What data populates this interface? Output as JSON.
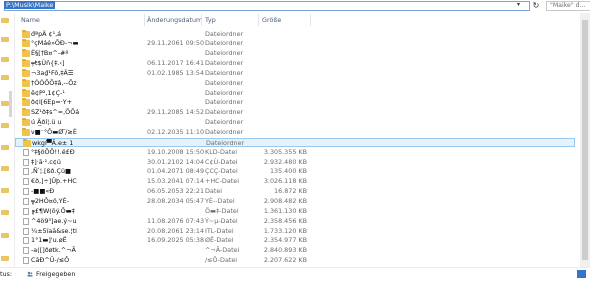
{
  "address": {
    "path": "P:\\Musik\\Maike",
    "search_placeholder": "\"Maike\" d..."
  },
  "headers": {
    "name": "Name",
    "date": "Änderungsdatum",
    "type": "Typ",
    "size": "Größe"
  },
  "rows": [
    {
      "name": "đªpÄ ¢¹‚á",
      "date": "",
      "type": "Dateiordner",
      "size": "",
      "icon": "folder-icon"
    },
    {
      "name": "°çMáé»ÕÐ-­¬▬",
      "date": "29.11.2061 09:50",
      "type": "Dateiordner",
      "size": "",
      "icon": "folder-icon"
    },
    {
      "name": "È§[†B¤^-#º",
      "date": "",
      "type": "Dateiordner",
      "size": "",
      "icon": "folder-icon"
    },
    {
      "name": "╤ŧ$Úñ{‡.‹]",
      "date": "06.11.2017 16:41",
      "type": "Dateiordner",
      "size": "",
      "icon": "folder-icon"
    },
    {
      "name": "¬3a₫¹Fõ,‡Ä☰",
      "date": "01.02.1985 13:54",
      "type": "Dateiordner",
      "size": "",
      "icon": "folder-icon"
    },
    {
      "name": "†ÓÓÕÕ‡â,--Õz",
      "date": "",
      "type": "Dateiordner",
      "size": "",
      "icon": "folder-icon"
    },
    {
      "name": "ê¢P²,1¢Ç-¹",
      "date": "",
      "type": "Dateiordner",
      "size": "",
      "icon": "folder-icon"
    },
    {
      "name": "ð¢l[6Ep=·Y+",
      "date": "",
      "type": "Dateiordner",
      "size": "",
      "icon": "folder-icon"
    },
    {
      "name": "SZ¹ð‡s^=,ÕÕá",
      "date": "29.11.2085 14:52",
      "type": "Dateiordner",
      "size": "",
      "icon": "folder-icon"
    },
    {
      "name": "ú Ä̲ðí¦.ü u",
      "date": "",
      "type": "Dateiordner",
      "size": "",
      "icon": "folder-icon"
    },
    {
      "name": "ν■⁻°Ô▬Ø ̅/≥È",
      "date": "02.12.2035 11:10",
      "type": "Dateiordner",
      "size": "",
      "icon": "folder-icon"
    },
    {
      "name": "wkgí▀Ã.e± 1",
      "date": "",
      "type": "Dateiordner",
      "size": "",
      "icon": "folder-icon",
      "selected": true
    },
    {
      "name": "°‡§öÕÕ!!.ë£Ð",
      "date": "19.10.2008 15:50",
      "type": "KLD-Datei",
      "size": "3.305.355 KB",
      "icon": "file-icon"
    },
    {
      "name": "‡]·ã·¹.c¢ü",
      "date": "30.01.2102 14:04",
      "type": "C¢Ù-Datei",
      "size": "2.932.480 KB",
      "icon": "file-icon"
    },
    {
      "name": "‚Ñ ́¦.[ßð.Çü■",
      "date": "01.04.2071 08:49",
      "type": "ÇCÇ-Datei",
      "size": "135.400 KB",
      "icon": "file-icon"
    },
    {
      "name": "€ð‚]÷]Ûþ.+HC",
      "date": "15.03.2041 07:14",
      "type": "+HC-Datei",
      "size": "3.026.118 KB",
      "icon": "file-icon"
    },
    {
      "name": "-■■«Ð",
      "date": "06.05.2053 22:21",
      "type": "Datei",
      "size": "16.872 KB",
      "icon": "file-icon"
    },
    {
      "name": "╦2HÔ¤ö,YÈ-",
      "date": "28.08.2034 05:47",
      "type": "YÈ--Datei",
      "size": "2.908.482 KB",
      "icon": "file-icon"
    },
    {
      "name": "╔£¶W(õý.Õ▬‡",
      "date": "",
      "type": "Õ▬‡-Datei",
      "size": "1.361.130 KB",
      "icon": "file-icon"
    },
    {
      "name": "^4ö9³]ae.ý~u",
      "date": "11.08.2076 07:43",
      "type": "Ý~µ-Datei",
      "size": "2.358.456 KB",
      "icon": "file-icon"
    },
    {
      "name": "¼±5ïaã&se.¦tl",
      "date": "20.08.2061 23:14",
      "type": "ITL-Datei",
      "size": "1.733.120 KB",
      "icon": "file-icon"
    },
    {
      "name": "1°1▬]'u.øË",
      "date": "16.09.2025 05:38",
      "type": "ØË-Datei",
      "size": "2.354.977 KB",
      "icon": "file-icon"
    },
    {
      "name": "-a([]ðøtk.^¬Ã",
      "date": "",
      "type": "^¬Ã-Datei",
      "size": "2.840.893 KB",
      "icon": "file-icon"
    },
    {
      "name": "CãÐ^Ü‑/≤Ô",
      "date": "",
      "type": "/≤Ô-Datei",
      "size": "2.207.622 KB",
      "icon": "file-icon"
    }
  ],
  "status": {
    "text": "tus:",
    "share": "Freigegeben"
  },
  "colors": {
    "accent": "#3574c6",
    "folder": "#f0c44c",
    "header_text": "#4c607a",
    "selected_bg": "#e5f1fb"
  }
}
